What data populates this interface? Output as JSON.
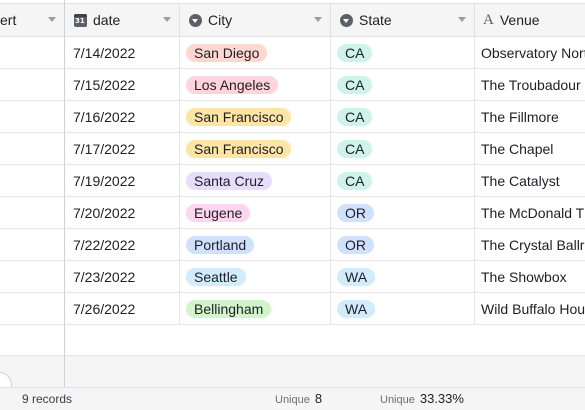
{
  "columns": {
    "first": {
      "label": "ert"
    },
    "date": {
      "label": "date",
      "icon": "calendar-icon"
    },
    "city": {
      "label": "City",
      "icon": "single-select-icon"
    },
    "state": {
      "label": "State",
      "icon": "single-select-icon"
    },
    "venue": {
      "label": "Venue",
      "icon": "text-field-icon"
    }
  },
  "rows": [
    {
      "date": "7/14/2022",
      "city": "San Diego",
      "city_color": "#fed7cf",
      "state": "CA",
      "state_color": "#cdf3ea",
      "venue": "Observatory North Park"
    },
    {
      "date": "7/15/2022",
      "city": "Los Angeles",
      "city_color": "#ffd4dc",
      "state": "CA",
      "state_color": "#cdf3ea",
      "venue": "The Troubadour"
    },
    {
      "date": "7/16/2022",
      "city": "San Francisco",
      "city_color": "#fde5a6",
      "state": "CA",
      "state_color": "#cdf3ea",
      "venue": "The Fillmore"
    },
    {
      "date": "7/17/2022",
      "city": "San Francisco",
      "city_color": "#fde5a6",
      "state": "CA",
      "state_color": "#cdf3ea",
      "venue": "The Chapel"
    },
    {
      "date": "7/19/2022",
      "city": "Santa Cruz",
      "city_color": "#e8dcfd",
      "state": "CA",
      "state_color": "#cdf3ea",
      "venue": "The Catalyst"
    },
    {
      "date": "7/20/2022",
      "city": "Eugene",
      "city_color": "#fcd5f0",
      "state": "OR",
      "state_color": "#d1e1fd",
      "venue": "The McDonald Theatre"
    },
    {
      "date": "7/22/2022",
      "city": "Portland",
      "city_color": "#d1e1fd",
      "state": "OR",
      "state_color": "#d1e1fd",
      "venue": "The Crystal Ballroom"
    },
    {
      "date": "7/23/2022",
      "city": "Seattle",
      "city_color": "#d0ecfd",
      "state": "WA",
      "state_color": "#d0ecfd",
      "venue": "The Showbox"
    },
    {
      "date": "7/26/2022",
      "city": "Bellingham",
      "city_color": "#d1f4cd",
      "state": "WA",
      "state_color": "#d0ecfd",
      "venue": "Wild Buffalo House of Music"
    }
  ],
  "footer": {
    "records": "9 records",
    "city_summary_label": "Unique",
    "city_summary_value": "8",
    "state_summary_label": "Unique",
    "state_summary_value": "33.33%"
  }
}
